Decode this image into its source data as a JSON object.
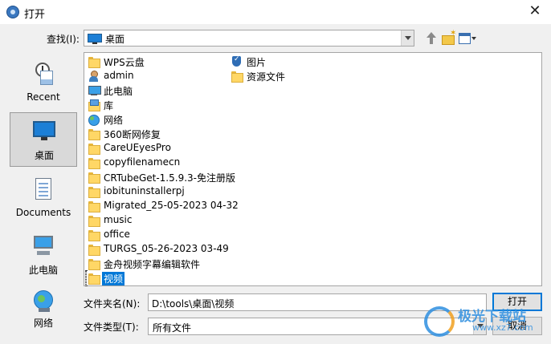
{
  "window": {
    "title": "打开"
  },
  "toolbar": {
    "look_in_label": "查找(I):",
    "look_in_value": "桌面"
  },
  "places": [
    {
      "label": "Recent",
      "icon": "recent-icon"
    },
    {
      "label": "桌面",
      "icon": "desktop-icon",
      "selected": true
    },
    {
      "label": "Documents",
      "icon": "documents-icon"
    },
    {
      "label": "此电脑",
      "icon": "this-pc-icon"
    },
    {
      "label": "网络",
      "icon": "network-icon"
    }
  ],
  "files": {
    "col1": [
      {
        "name": "WPS云盘",
        "icon": "folder-icon"
      },
      {
        "name": "admin",
        "icon": "user-icon"
      },
      {
        "name": "此电脑",
        "icon": "computer-icon"
      },
      {
        "name": "库",
        "icon": "library-icon"
      },
      {
        "name": "网络",
        "icon": "network-icon"
      },
      {
        "name": "360断网修复",
        "icon": "folder-icon"
      },
      {
        "name": "CareUEyesPro",
        "icon": "folder-icon"
      },
      {
        "name": "copyfilenamecn",
        "icon": "folder-icon"
      },
      {
        "name": "CRTubeGet-1.5.9.3-免注册版",
        "icon": "folder-icon"
      },
      {
        "name": "iobituninstallerpj",
        "icon": "folder-icon"
      },
      {
        "name": "Migrated_25-05-2023 04-32",
        "icon": "folder-icon"
      },
      {
        "name": "music",
        "icon": "folder-icon"
      },
      {
        "name": "office",
        "icon": "folder-icon"
      },
      {
        "name": "TURGS_05-26-2023 03-49",
        "icon": "folder-icon"
      },
      {
        "name": "金舟视频字幕编辑软件",
        "icon": "folder-icon"
      },
      {
        "name": "视频",
        "icon": "folder-icon",
        "selected": true
      }
    ],
    "col2": [
      {
        "name": "图片",
        "icon": "pictures-icon"
      },
      {
        "name": "资源文件",
        "icon": "folder-icon"
      }
    ]
  },
  "bottom": {
    "filename_label": "文件夹名(N):",
    "filename_value": "D:\\tools\\桌面\\视频",
    "filetype_label": "文件类型(T):",
    "filetype_value": "所有文件",
    "open_label": "打开",
    "cancel_label": "取消"
  },
  "watermark": {
    "text": "极光下载站",
    "url": "www.xz7.com"
  },
  "colors": {
    "selection": "#0078d7",
    "folder": "#ffd766"
  }
}
